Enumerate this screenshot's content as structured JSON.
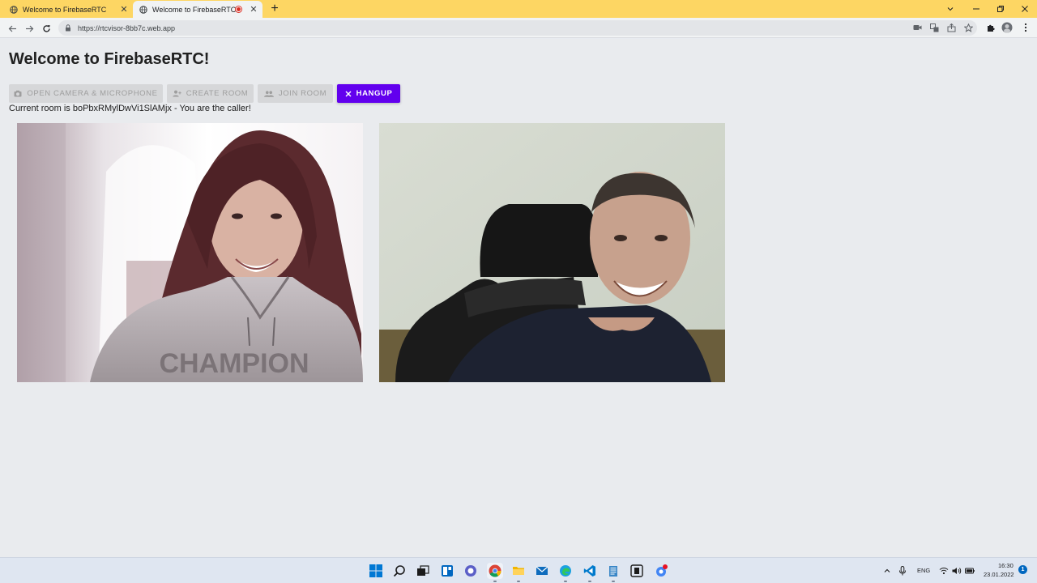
{
  "browser": {
    "tabs": [
      {
        "title": "Welcome to FirebaseRTC",
        "active": false
      },
      {
        "title": "Welcome to FirebaseRTC",
        "active": true,
        "recording": true
      }
    ],
    "new_tab_label": "+",
    "url": "https://rtcvisor-8bb7c.web.app"
  },
  "page": {
    "title": "Welcome to FirebaseRTC!",
    "buttons": [
      {
        "label": "Open camera & microphone",
        "icon": "camera-icon",
        "disabled": true
      },
      {
        "label": "Create room",
        "icon": "add-person-icon",
        "disabled": true
      },
      {
        "label": "Join room",
        "icon": "group-icon",
        "disabled": true
      },
      {
        "label": "Hangup",
        "icon": "close-icon",
        "disabled": false
      }
    ],
    "status": "Current room is boPbxRMylDwVi1SlAMjx - You are the caller!",
    "videos": [
      {
        "role": "local-video",
        "shirt_text": "CHAMPION"
      },
      {
        "role": "remote-video"
      }
    ]
  },
  "taskbar": {
    "language": "ENG",
    "time": "16:30",
    "date": "23.01.2022",
    "notification_count": "1"
  },
  "colors": {
    "tab_bar": "#fdd663",
    "accent": "#6200ee",
    "page_bg": "#e9ebee"
  }
}
